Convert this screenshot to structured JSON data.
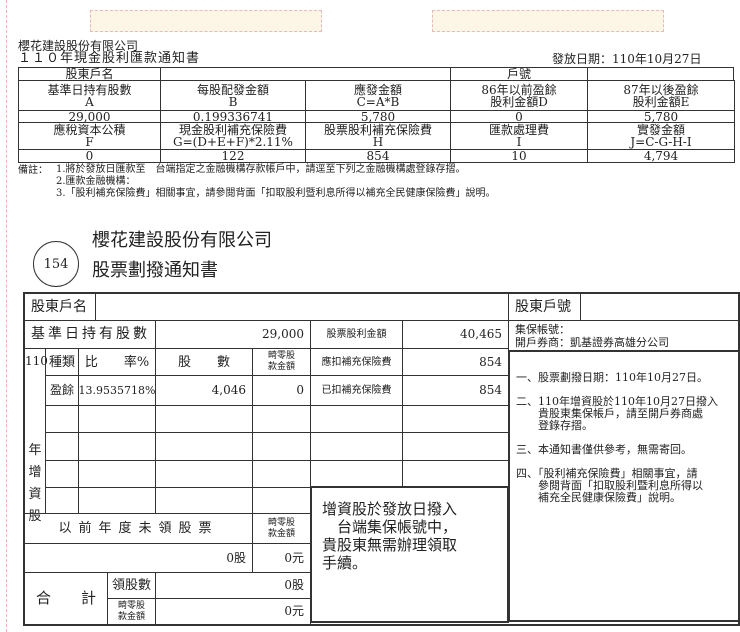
{
  "top": {
    "company": "櫻花建設股份有限公司",
    "title": "１１０年現金股利匯款通知書",
    "issue_date": "發放日期：110年10月27日",
    "table": {
      "holder_name_label": "股東戶名",
      "account_label": "戶號",
      "h1": [
        "基準日持有股數\nA",
        "每股配發金額\nB",
        "應發金額\nC=A*B",
        "86年以前盈餘\n股利金額D",
        "87年以後盈餘\n股利金額E"
      ],
      "v1": [
        "29,000",
        "0.199336741",
        "5,780",
        "0",
        "5,780"
      ],
      "h2": [
        "應稅資本公積\nF",
        "現金股利補充保險費\nG=(D+E+F)*2.11%",
        "股票股利補充保險費\nH",
        "匯款處理費\nI",
        "實發金額\nJ=C-G-H-I"
      ],
      "v2": [
        "0",
        "122",
        "854",
        "10",
        "4,794"
      ]
    },
    "notes_label": "備註：",
    "notes": [
      "1.將於發放日匯款至　台端指定之金融機構存款帳戶中，請逕至下列之金融機構處登錄存摺。",
      "2.匯款金融機構：",
      "3.「股利補充保險費」相關事宜，請參閱背面「扣取股利暨利息所得以補充全民健康保險費」說明。"
    ]
  },
  "notice": {
    "number": "154",
    "company": "櫻花建設股份有限公司",
    "title": "股票劃撥通知書"
  },
  "lower": {
    "holder_name_label": "股東戶名",
    "holder_no_label": "股東戶號",
    "base_shares_label": "基準日持有股數",
    "base_shares": "29,000",
    "stock_div_label": "股票股利金額",
    "stock_div": "40,465",
    "year": "110",
    "year_vertical": "年增資股",
    "col_type": "種類",
    "col_rate": "比　　率%",
    "col_shares": "股　　數",
    "col_fraction": "畸零股\n款金額",
    "withhold_label": "應扣補充保險費",
    "withhold": "854",
    "withheld_label": "已扣補充保險費",
    "withheld": "854",
    "row_type": "盈餘",
    "row_rate": "13.9535718%",
    "row_shares": "4,046",
    "row_fraction": "0",
    "prev_label": "以前年度未領股票",
    "prev_fraction_label": "畸零股\n款金額",
    "prev_shares": "0股",
    "prev_amount": "0元",
    "total_label": "合　　計",
    "total_shares_label": "領股數",
    "total_shares": "0股",
    "total_fraction_label": "畸零股\n款金額",
    "total_amount": "0元",
    "box_text": "增資股於發放日撥入\n　台端集保帳號中，\n貴股東無需辦理領取\n手續。",
    "depository_label": "集保帳號：",
    "broker": "開戶券商：凱基證券高雄分公司",
    "right_notes": [
      "一、股票劃撥日期：110年10月27日。",
      "二、110年增資股於110年10月27日撥入\n　　貴股東集保帳戶，請至開戶券商處\n　　登錄存摺。",
      "三、本通知書僅供參考，無需寄回。",
      "四、「股利補充保險費」相關事宜，請\n　　參閱背面「扣取股利暨利息所得以\n　　補充全民健康保險費」說明。"
    ]
  }
}
